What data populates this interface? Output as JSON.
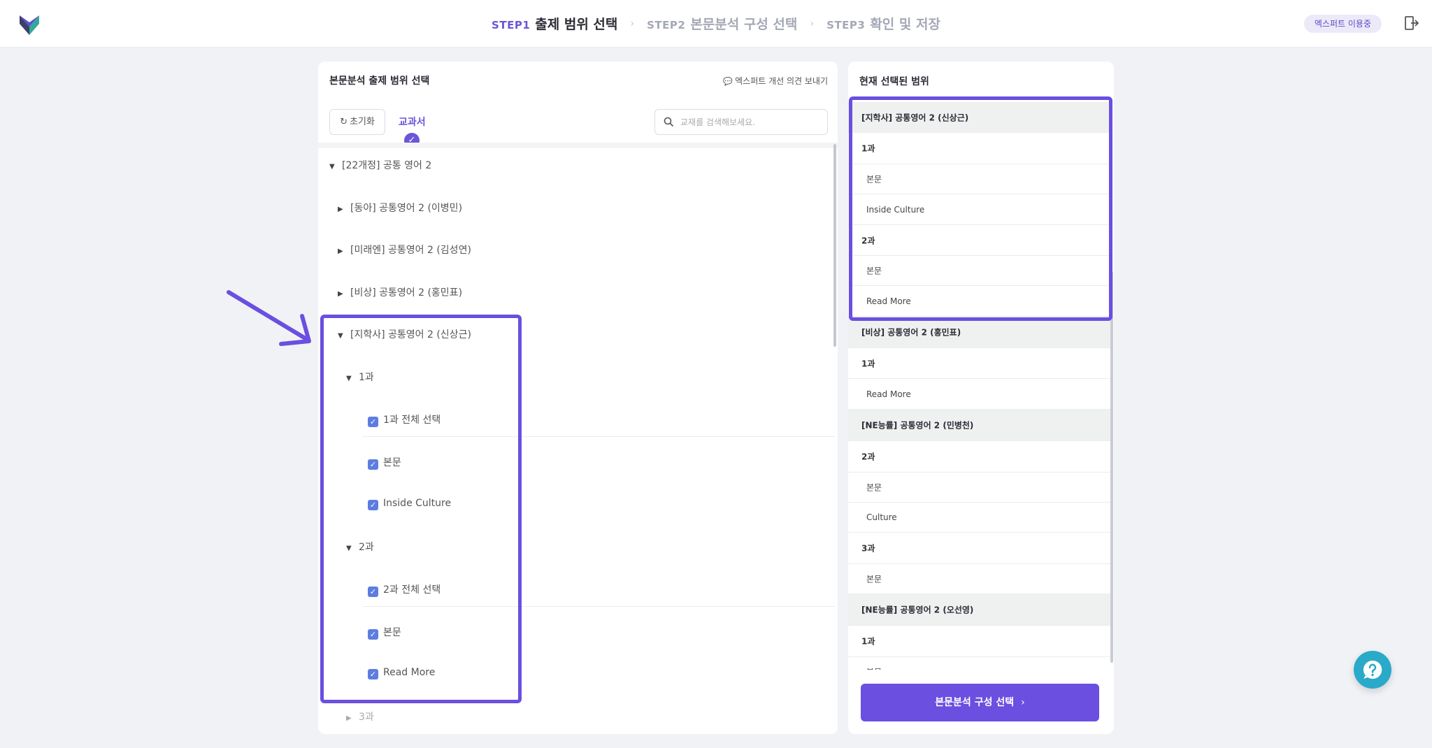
{
  "header": {
    "steps": [
      {
        "num": "STEP1",
        "label": "출제 범위 선택",
        "active": true
      },
      {
        "num": "STEP2",
        "label": "본문분석 구성 선택",
        "active": false
      },
      {
        "num": "STEP3",
        "label": "확인 및 저장",
        "active": false
      }
    ],
    "badge": "엑스퍼트 이용중",
    "icons": {
      "logo": "brand-logo",
      "exit": "exit-icon"
    }
  },
  "left_panel": {
    "title": "본문분석 출제 범위 선택",
    "feedback_link": "엑스퍼트 개선 의견 보내기",
    "reset_label": "초기화",
    "tab_label": "교과서",
    "search_placeholder": "교재를 검색해보세요.",
    "tree": [
      {
        "label": "[22개정] 공통 영어 2",
        "expanded": true
      },
      {
        "label": "[동아] 공통영어 2 (이병민)",
        "expanded": false
      },
      {
        "label": "[미래엔] 공통영어 2 (김성연)",
        "expanded": false
      },
      {
        "label": "[비상] 공통영어 2 (홍민표)",
        "expanded": false
      },
      {
        "label": "[지학사] 공통영어 2 (신상근)",
        "expanded": true
      },
      {
        "label": "1과",
        "expanded": true
      },
      {
        "label": "1과 전체 선택",
        "checked": true
      },
      {
        "label": "본문",
        "checked": true
      },
      {
        "label": "Inside Culture",
        "checked": true
      },
      {
        "label": "2과",
        "expanded": true
      },
      {
        "label": "2과 전체 선택",
        "checked": true
      },
      {
        "label": "본문",
        "checked": true
      },
      {
        "label": "Read More",
        "checked": true
      },
      {
        "label": "3과",
        "expanded": false
      }
    ]
  },
  "right_panel": {
    "title": "현재 선택된 범위",
    "items": [
      {
        "type": "book",
        "label": "[지학사] 공통영어 2 (신상근)"
      },
      {
        "type": "lesson",
        "label": "1과"
      },
      {
        "type": "part",
        "label": "본문"
      },
      {
        "type": "part",
        "label": "Inside Culture"
      },
      {
        "type": "lesson",
        "label": "2과"
      },
      {
        "type": "part",
        "label": "본문"
      },
      {
        "type": "part",
        "label": "Read More"
      },
      {
        "type": "book",
        "label": "[비상] 공통영어 2 (홍민표)"
      },
      {
        "type": "lesson",
        "label": "1과"
      },
      {
        "type": "part",
        "label": "Read More"
      },
      {
        "type": "book",
        "label": "[NE능률] 공통영어 2 (민병천)"
      },
      {
        "type": "lesson",
        "label": "2과"
      },
      {
        "type": "part",
        "label": "본문"
      },
      {
        "type": "part",
        "label": "Culture"
      },
      {
        "type": "lesson",
        "label": "3과"
      },
      {
        "type": "part",
        "label": "본문"
      },
      {
        "type": "book",
        "label": "[NE능률] 공통영어 2 (오선영)"
      },
      {
        "type": "lesson",
        "label": "1과"
      },
      {
        "type": "part",
        "label": "본문"
      }
    ],
    "action_label": "본문분석 구성 선택"
  },
  "colors": {
    "accent": "#6a4fe0",
    "checkbox": "#5d7de0",
    "fab": "#2aa9c9"
  }
}
